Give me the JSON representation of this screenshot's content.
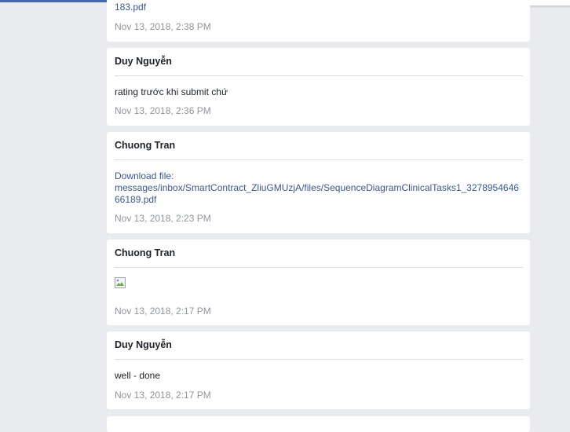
{
  "messages": [
    {
      "author": "",
      "download_prefix": "",
      "link_text": "183.pdf",
      "text": "",
      "time": "Nov 13, 2018, 2:38 PM"
    },
    {
      "author": "Duy Nguyễn",
      "text": "rating trước khi submit chứ",
      "time": "Nov 13, 2018, 2:36 PM"
    },
    {
      "author": "Chuong Tran",
      "download_prefix": "Download file:",
      "link_text": "messages/inbox/SmartContract_ZliuGMUzjA/files/SequenceDiagramClinicalTasks1_327895464666189.pdf",
      "time": "Nov 13, 2018, 2:23 PM"
    },
    {
      "author": "Chuong Tran",
      "image": "broken-image-icon",
      "time": "Nov 13, 2018, 2:17 PM"
    },
    {
      "author": "Duy Nguyễn",
      "text": "well - done",
      "time": "Nov 13, 2018, 2:17 PM"
    }
  ],
  "colors": {
    "background": "#e9ebee",
    "card": "#ffffff",
    "link": "#365899",
    "timestamp": "#90949c",
    "accent": "#4267b2"
  }
}
